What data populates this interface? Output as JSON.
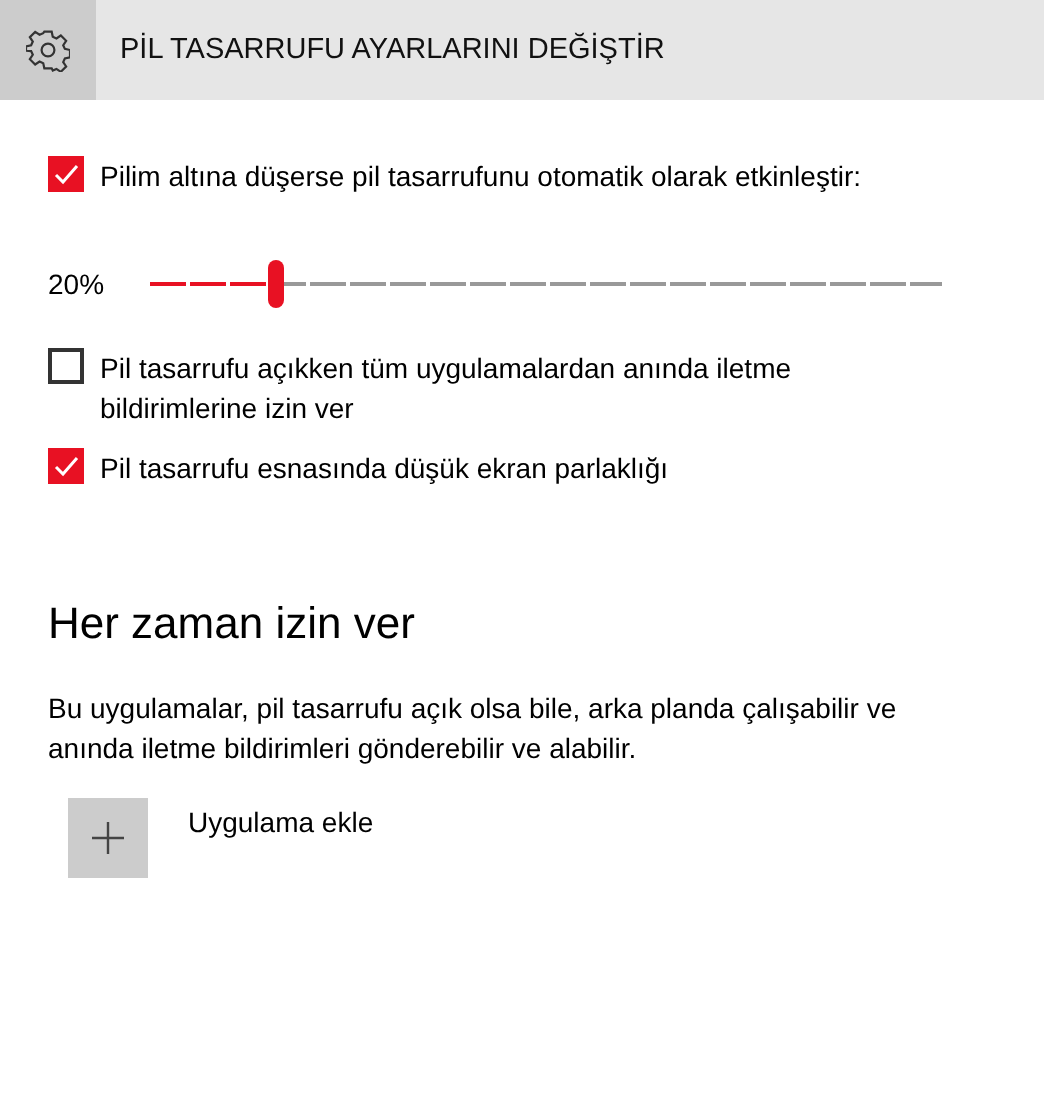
{
  "header": {
    "title": "PİL TASARRUFU AYARLARINI DEĞİŞTİR"
  },
  "auto_enable": {
    "label": "Pilim altına düşerse pil tasarrufunu otomatik olarak etkinleştir:",
    "checked": true
  },
  "threshold": {
    "reading": "20%",
    "level": 0.16
  },
  "options": [
    {
      "label": "Pil tasarrufu açıkken tüm uygulamalardan anında iletme bildirimlerine izin ver",
      "checked": false
    },
    {
      "label": "Pil tasarrufu esnasında düşük ekran parlaklığı",
      "checked": true
    }
  ],
  "section": {
    "heading": "Her zaman izin ver",
    "description": "Bu uygulamalar, pil tasarrufu açık olsa bile, arka planda çalışabilir ve anında iletme bildirimleri gönderebilir ve alabilir.",
    "add_button": "Uygulama ekle"
  }
}
